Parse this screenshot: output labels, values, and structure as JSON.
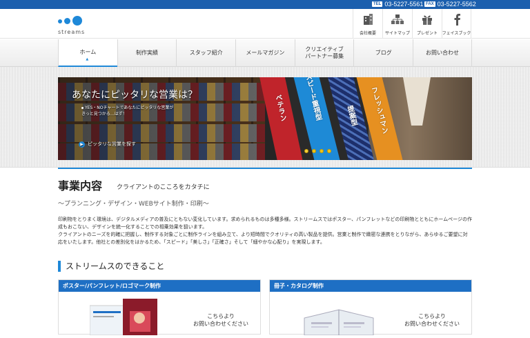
{
  "topbar": {
    "tel_tag": "TEL",
    "tel": "03-5227-5561",
    "fax_tag": "FAX",
    "fax": "03-5227-5562"
  },
  "logo": {
    "wordmark": "streams"
  },
  "utility": [
    {
      "icon": "building-icon",
      "label": "会社概要"
    },
    {
      "icon": "sitemap-icon",
      "label": "サイトマップ"
    },
    {
      "icon": "gift-icon",
      "label": "プレゼント"
    },
    {
      "icon": "facebook-icon",
      "label": "フェイスブック"
    }
  ],
  "nav": [
    {
      "label": "ホーム",
      "active": true
    },
    {
      "label": "制作実績"
    },
    {
      "label": "スタッフ紹介"
    },
    {
      "label": "メールマガジン"
    },
    {
      "label": "クリエイティブ\nパートナー募集"
    },
    {
      "label": "ブログ"
    },
    {
      "label": "お問い合わせ"
    }
  ],
  "banner": {
    "headline": "あなたにピッタリな営業は？",
    "sub": "YES・NOチャートであなたにピッタリな営業が\nきっと見つかる…はず！",
    "cta": "ピッタリな営業を探す",
    "ties": [
      "ベテラン",
      "スピード重視型",
      "提案型",
      "フレッシュマン"
    ],
    "pager_count": 4,
    "pager_active": 0
  },
  "business": {
    "title": "事業内容",
    "catch": "クライアントのこころをカタチに",
    "sub": "～プランニング・デザイン・WEBサイト制作・印刷～",
    "body": "印刷物をとりまく環境は、デジタルメディアの普及にともない変化しています。求められるものは多種多様。ストリームスではポスター、パンフレットなどの印刷物とともにホームページの作成もおこない、デザインを統一化することでの相乗効果を狙います。\nクライアントのニーズを的確に把握し、制作する対象ごとに制作ラインを組み立て、より短時間でクオリティの高い製品を提供。営業と制作で緻密な連携をとりながら、あらゆるご要望に対応をいたします。他社との差別化をはかるため、「スピード」「美しさ」「正確さ」そして「細やかな心配り」を実現します。"
  },
  "capabilities": {
    "title": "ストリームスのできること",
    "cards": [
      {
        "heading": "ポスター/パンフレット/ロゴマーク制作",
        "cta": "こちらより\nお問い合わせください"
      },
      {
        "heading": "冊子・カタログ制作",
        "cta": "こちらより\nお問い合わせください"
      }
    ]
  },
  "colors": {
    "brand": "#1e88d8",
    "topbar": "#1b5fae",
    "card_header": "#1e6fc4"
  }
}
